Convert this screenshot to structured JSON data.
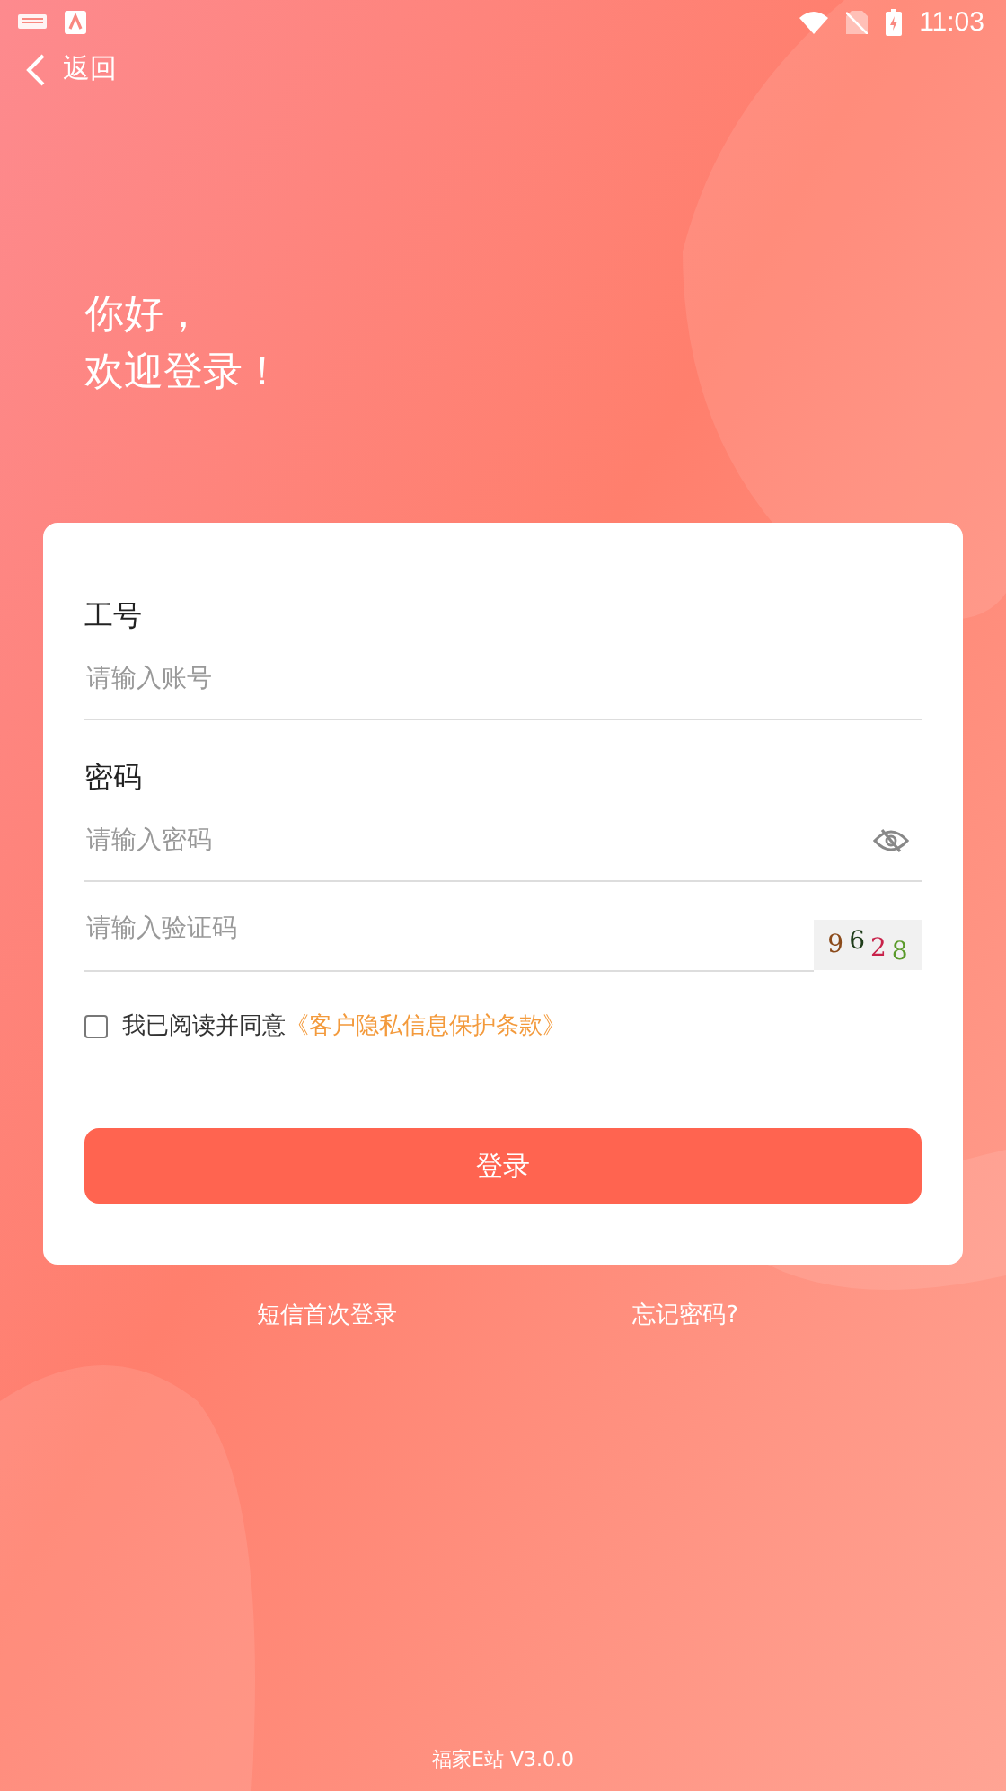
{
  "status_bar": {
    "time": "11:03"
  },
  "nav": {
    "back_label": "返回"
  },
  "greeting": [
    "你好，",
    "欢迎登录！"
  ],
  "form": {
    "account": {
      "label": "工号",
      "placeholder": "请输入账号"
    },
    "password": {
      "label": "密码",
      "placeholder": "请输入密码"
    },
    "captcha": {
      "placeholder": "请输入验证码",
      "chars": [
        {
          "char": "9",
          "color": "#8b4a1a"
        },
        {
          "char": "6",
          "color": "#1f3d1a"
        },
        {
          "char": "2",
          "color": "#c8224a"
        },
        {
          "char": "8",
          "color": "#5a9a2a"
        }
      ]
    },
    "agreement": {
      "checked": false,
      "text": "我已阅读并同意",
      "link": "《客户隐私信息保护条款》"
    },
    "submit": "登录"
  },
  "links": [
    "短信首次登录",
    "忘记密码?"
  ],
  "version": "福家E站 V3.0.0"
}
